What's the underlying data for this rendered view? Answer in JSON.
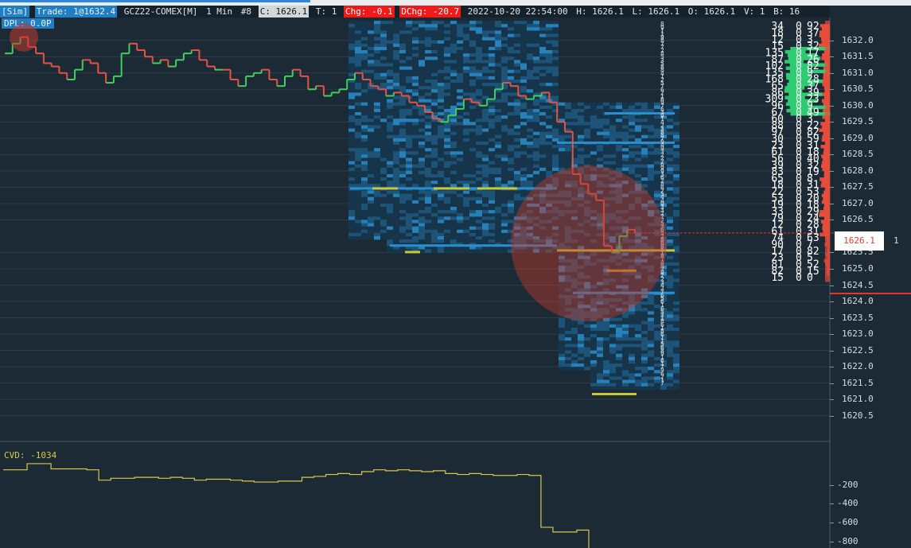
{
  "infobar": {
    "mode": "[Sim]",
    "trade": "Trade: 1@1632.4",
    "symbol": "GCZ22-COMEX[M]",
    "interval": "1 Min",
    "bar_number": "#8",
    "close": "C: 1626.1",
    "trades": "T: 1",
    "chg": "Chg: -0.1",
    "dchg": "DChg: -20.7",
    "datetime": "2022-10-20 22:54:00",
    "high": "H: 1626.1",
    "low": "L: 1626.1",
    "open": "O: 1626.1",
    "volume": "V: 1",
    "bid": "B: 16"
  },
  "dpl": "DPL: 0.0P",
  "current_price": "1626.1",
  "side_value": "1",
  "price_axis": {
    "labels": [
      "1632.0",
      "1631.5",
      "1631.0",
      "1630.5",
      "1630.0",
      "1629.5",
      "1629.0",
      "1628.5",
      "1628.0",
      "1627.5",
      "1627.0",
      "1626.5",
      "1625.5",
      "1625.0",
      "1624.5",
      "1624.0",
      "1623.5",
      "1623.0",
      "1622.5",
      "1622.0",
      "1621.5",
      "1621.0",
      "1620.5"
    ],
    "values": [
      1632.0,
      1631.5,
      1631.0,
      1630.5,
      1630.0,
      1629.5,
      1629.0,
      1628.5,
      1628.0,
      1627.5,
      1627.0,
      1626.5,
      1625.5,
      1625.0,
      1624.5,
      1624.0,
      1623.5,
      1623.0,
      1622.5,
      1622.0,
      1621.5,
      1621.0,
      1620.5
    ],
    "range": [
      1620.2,
      1632.7
    ]
  },
  "cvd": {
    "label": "CVD: -1034",
    "axis_labels": [
      "-200",
      "-400",
      "-600",
      "-800"
    ],
    "axis_values": [
      -200,
      -400,
      -600,
      -800
    ],
    "range": [
      -870,
      50
    ],
    "series": [
      -40,
      -40,
      25,
      25,
      -30,
      -30,
      -30,
      -40,
      -150,
      -130,
      -130,
      -120,
      -120,
      -130,
      -120,
      -130,
      -150,
      -140,
      -140,
      -150,
      -160,
      -170,
      -170,
      -160,
      -160,
      -120,
      -110,
      -90,
      -80,
      -90,
      -60,
      -40,
      -50,
      -40,
      -50,
      -60,
      -50,
      -80,
      -90,
      -80,
      -90,
      -100,
      -100,
      -90,
      -100,
      -650,
      -700,
      -700,
      -680,
      -900
    ]
  },
  "price_series": {
    "closes": [
      1631.6,
      1631.9,
      1632.1,
      1631.8,
      1631.6,
      1631.3,
      1631.2,
      1631.0,
      1630.8,
      1631.1,
      1631.4,
      1631.3,
      1631.0,
      1630.7,
      1630.9,
      1631.6,
      1631.9,
      1631.7,
      1631.5,
      1631.3,
      1631.4,
      1631.2,
      1631.4,
      1631.6,
      1631.7,
      1631.4,
      1631.2,
      1631.1,
      1631.1,
      1630.8,
      1630.6,
      1630.9,
      1631.0,
      1631.1,
      1630.8,
      1630.6,
      1630.9,
      1631.1,
      1630.9,
      1630.5,
      1630.6,
      1630.3,
      1630.4,
      1630.5,
      1630.8,
      1631.0,
      1630.8,
      1630.6,
      1630.5,
      1630.3,
      1630.4,
      1630.3,
      1630.1,
      1630.0,
      1629.8,
      1629.6,
      1629.5,
      1629.7,
      1629.9,
      1630.2,
      1630.1,
      1630.0,
      1630.2,
      1630.5,
      1630.7,
      1630.6,
      1630.3,
      1630.2,
      1630.3,
      1630.4,
      1630.1,
      1629.5,
      1629.2,
      1627.9,
      1627.6,
      1627.3,
      1627.1,
      1625.7,
      1625.5,
      1626.0,
      1626.2,
      1626.1
    ]
  },
  "dom_ladder": [
    {
      "vol": "34",
      "bid": "0",
      "ask": "92"
    },
    {
      "vol": "18",
      "bid": "0",
      "ask": "37"
    },
    {
      "vol": "12",
      "bid": "0",
      "ask": "3"
    },
    {
      "vol": "15",
      "bid": "0",
      "ask": "32"
    },
    {
      "vol": "135",
      "bid": "0",
      "ask": "17"
    },
    {
      "vol": "87",
      "bid": "0",
      "ask": "26"
    },
    {
      "vol": "102",
      "bid": "0",
      "ask": "82"
    },
    {
      "vol": "135",
      "bid": "0",
      "ask": "9"
    },
    {
      "vol": "168",
      "bid": "0",
      "ask": "28"
    },
    {
      "vol": "65",
      "bid": "0",
      "ask": "37"
    },
    {
      "vol": "86",
      "bid": "0",
      "ask": "39"
    },
    {
      "vol": "309",
      "bid": "0",
      "ask": "23"
    },
    {
      "vol": "96",
      "bid": "0",
      "ask": "9"
    },
    {
      "vol": "67",
      "bid": "0",
      "ask": "49"
    },
    {
      "vol": "60",
      "bid": "0",
      "ask": "3"
    },
    {
      "vol": "88",
      "bid": "0",
      "ask": "22"
    },
    {
      "vol": "97",
      "bid": "0",
      "ask": "82"
    },
    {
      "vol": "30",
      "bid": "0",
      "ask": "59"
    },
    {
      "vol": "23",
      "bid": "0",
      "ask": "31"
    },
    {
      "vol": "61",
      "bid": "0",
      "ask": "18"
    },
    {
      "vol": "56",
      "bid": "0",
      "ask": "40"
    },
    {
      "vol": "39",
      "bid": "0",
      "ask": "32"
    },
    {
      "vol": "83",
      "bid": "0",
      "ask": "19"
    },
    {
      "vol": "65",
      "bid": "0",
      "ask": "8"
    },
    {
      "vol": "18",
      "bid": "0",
      "ask": "31"
    },
    {
      "vol": "22",
      "bid": "0",
      "ask": "53"
    },
    {
      "vol": "53",
      "bid": "0",
      "ask": "20"
    },
    {
      "vol": "19",
      "bid": "0",
      "ask": "18"
    },
    {
      "vol": "33",
      "bid": "0",
      "ask": "29"
    },
    {
      "vol": "79",
      "bid": "0",
      "ask": "24"
    },
    {
      "vol": "12",
      "bid": "0",
      "ask": "28"
    },
    {
      "vol": "61",
      "bid": "0",
      "ask": "31"
    },
    {
      "vol": "74",
      "bid": "0",
      "ask": "63"
    },
    {
      "vol": "90",
      "bid": "0",
      "ask": "7"
    },
    {
      "vol": "17",
      "bid": "0",
      "ask": "82"
    },
    {
      "vol": "23",
      "bid": "0",
      "ask": "5"
    },
    {
      "vol": "81",
      "bid": "0",
      "ask": "52"
    },
    {
      "vol": "82",
      "bid": "0",
      "ask": "15"
    },
    {
      "vol": "15",
      "bid": "0",
      "ask": "0"
    }
  ],
  "colors": {
    "background": "#1b2a35",
    "up_candle": "#3fcf5d",
    "down_candle": "#e65246",
    "cvd_line": "#d8c84a",
    "heatmap_dark": "#15364e",
    "heatmap_mid": "#1d5a82",
    "heatmap_bright": "#2a8fd0",
    "heat_yellow": "#c8c83a",
    "bid_green": "#2ecc71",
    "ask_red": "#e74c3c",
    "price_marker": "#e0392c"
  }
}
